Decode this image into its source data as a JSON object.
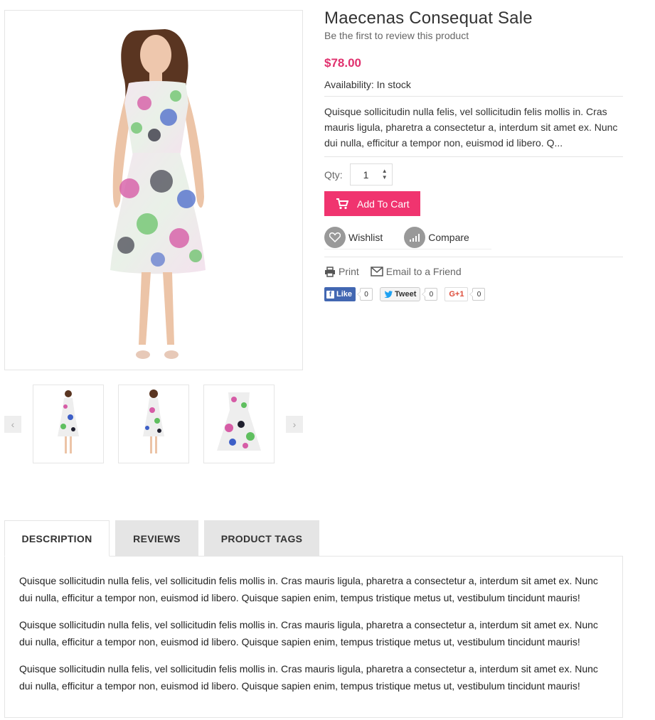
{
  "product": {
    "title": "Maecenas Consequat Sale",
    "review_link": "Be the first to review this product",
    "price": "$78.00",
    "availability": "Availability: In stock",
    "short_description": "Quisque sollicitudin nulla felis, vel sollicitudin felis mollis in. Cras mauris ligula, pharetra a consectetur a, interdum sit amet ex. Nunc dui nulla, efficitur a tempor non, euismod id libero. Q...",
    "qty_label": "Qty:",
    "qty_value": "1",
    "add_to_cart": "Add To Cart",
    "wishlist": "Wishlist",
    "compare": "Compare",
    "print": "Print",
    "email_friend": "Email to a Friend"
  },
  "social": {
    "like_label": "Like",
    "like_count": "0",
    "tweet_label": "Tweet",
    "tweet_count": "0",
    "gplus_label": "G+1",
    "gplus_count": "0"
  },
  "gallery": {
    "prev_icon": "‹",
    "next_icon": "›"
  },
  "tabs": [
    {
      "label": "DESCRIPTION",
      "active": true
    },
    {
      "label": "REVIEWS",
      "active": false
    },
    {
      "label": "PRODUCT TAGS",
      "active": false
    }
  ],
  "description": {
    "paragraphs": [
      "Quisque sollicitudin nulla felis, vel sollicitudin felis mollis in. Cras mauris ligula, pharetra a consectetur a, interdum sit amet ex. Nunc dui nulla, efficitur a tempor non, euismod id libero. Quisque sapien enim, tempus tristique metus ut, vestibulum tincidunt mauris!",
      "Quisque sollicitudin nulla felis, vel sollicitudin felis mollis in. Cras mauris ligula, pharetra a consectetur a, interdum sit amet ex. Nunc dui nulla, efficitur a tempor non, euismod id libero. Quisque sapien enim, tempus tristique metus ut, vestibulum tincidunt mauris!",
      "Quisque sollicitudin nulla felis, vel sollicitudin felis mollis in. Cras mauris ligula, pharetra a consectetur a, interdum sit amet ex. Nunc dui nulla, efficitur a tempor non, euismod id libero. Quisque sapien enim, tempus tristique metus ut, vestibulum tincidunt mauris!"
    ]
  },
  "colors": {
    "accent": "#f0346f",
    "price": "#e0316e",
    "facebook": "#4267b2"
  },
  "icons": {
    "cart": "cart-icon",
    "wishlist": "heart-icon",
    "compare": "bar-chart-icon",
    "print": "printer-icon",
    "email": "envelope-icon"
  }
}
